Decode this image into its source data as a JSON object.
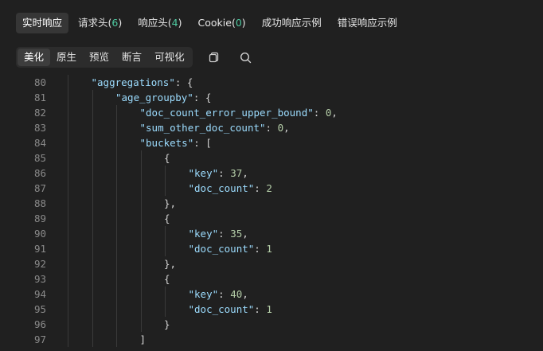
{
  "tabs": [
    {
      "label": "实时响应",
      "count": "",
      "active": true
    },
    {
      "label": "请求头",
      "count": "6",
      "active": false
    },
    {
      "label": "响应头",
      "count": "4",
      "active": false
    },
    {
      "label": "Cookie",
      "count": "0",
      "active": false
    },
    {
      "label": "成功响应示例",
      "count": "",
      "active": false
    },
    {
      "label": "错误响应示例",
      "count": "",
      "active": false
    }
  ],
  "view_modes": [
    {
      "label": "美化",
      "active": true
    },
    {
      "label": "原生",
      "active": false
    },
    {
      "label": "预览",
      "active": false
    },
    {
      "label": "断言",
      "active": false
    },
    {
      "label": "可视化",
      "active": false
    }
  ],
  "tools": [
    {
      "name": "copy-icon"
    },
    {
      "name": "search-icon"
    }
  ],
  "colors": {
    "background": "#202020",
    "json_key": "#9cdcfe",
    "json_number": "#b5cea8",
    "count_accent": "#4ec9a0",
    "line_number": "#8a8a8a"
  },
  "code_lines": [
    {
      "num": "80",
      "indent": 1,
      "parts": [
        {
          "t": "\"aggregations\"",
          "c": "k"
        },
        {
          "t": ": {",
          "c": "p"
        }
      ]
    },
    {
      "num": "81",
      "indent": 2,
      "parts": [
        {
          "t": "\"age_groupby\"",
          "c": "k"
        },
        {
          "t": ": {",
          "c": "p"
        }
      ]
    },
    {
      "num": "82",
      "indent": 3,
      "parts": [
        {
          "t": "\"doc_count_error_upper_bound\"",
          "c": "k"
        },
        {
          "t": ": ",
          "c": "p"
        },
        {
          "t": "0",
          "c": "n"
        },
        {
          "t": ",",
          "c": "p"
        }
      ]
    },
    {
      "num": "83",
      "indent": 3,
      "parts": [
        {
          "t": "\"sum_other_doc_count\"",
          "c": "k"
        },
        {
          "t": ": ",
          "c": "p"
        },
        {
          "t": "0",
          "c": "n"
        },
        {
          "t": ",",
          "c": "p"
        }
      ]
    },
    {
      "num": "84",
      "indent": 3,
      "parts": [
        {
          "t": "\"buckets\"",
          "c": "k"
        },
        {
          "t": ": [",
          "c": "p"
        }
      ]
    },
    {
      "num": "85",
      "indent": 4,
      "parts": [
        {
          "t": "{",
          "c": "p"
        }
      ]
    },
    {
      "num": "86",
      "indent": 5,
      "parts": [
        {
          "t": "\"key\"",
          "c": "k"
        },
        {
          "t": ": ",
          "c": "p"
        },
        {
          "t": "37",
          "c": "n"
        },
        {
          "t": ",",
          "c": "p"
        }
      ]
    },
    {
      "num": "87",
      "indent": 5,
      "parts": [
        {
          "t": "\"doc_count\"",
          "c": "k"
        },
        {
          "t": ": ",
          "c": "p"
        },
        {
          "t": "2",
          "c": "n"
        }
      ]
    },
    {
      "num": "88",
      "indent": 4,
      "parts": [
        {
          "t": "},",
          "c": "p"
        }
      ]
    },
    {
      "num": "89",
      "indent": 4,
      "parts": [
        {
          "t": "{",
          "c": "p"
        }
      ]
    },
    {
      "num": "90",
      "indent": 5,
      "parts": [
        {
          "t": "\"key\"",
          "c": "k"
        },
        {
          "t": ": ",
          "c": "p"
        },
        {
          "t": "35",
          "c": "n"
        },
        {
          "t": ",",
          "c": "p"
        }
      ]
    },
    {
      "num": "91",
      "indent": 5,
      "parts": [
        {
          "t": "\"doc_count\"",
          "c": "k"
        },
        {
          "t": ": ",
          "c": "p"
        },
        {
          "t": "1",
          "c": "n"
        }
      ]
    },
    {
      "num": "92",
      "indent": 4,
      "parts": [
        {
          "t": "},",
          "c": "p"
        }
      ]
    },
    {
      "num": "93",
      "indent": 4,
      "parts": [
        {
          "t": "{",
          "c": "p"
        }
      ]
    },
    {
      "num": "94",
      "indent": 5,
      "parts": [
        {
          "t": "\"key\"",
          "c": "k"
        },
        {
          "t": ": ",
          "c": "p"
        },
        {
          "t": "40",
          "c": "n"
        },
        {
          "t": ",",
          "c": "p"
        }
      ]
    },
    {
      "num": "95",
      "indent": 5,
      "parts": [
        {
          "t": "\"doc_count\"",
          "c": "k"
        },
        {
          "t": ": ",
          "c": "p"
        },
        {
          "t": "1",
          "c": "n"
        }
      ]
    },
    {
      "num": "96",
      "indent": 4,
      "parts": [
        {
          "t": "}",
          "c": "p"
        }
      ]
    },
    {
      "num": "97",
      "indent": 3,
      "parts": [
        {
          "t": "]",
          "c": "p"
        }
      ]
    }
  ]
}
